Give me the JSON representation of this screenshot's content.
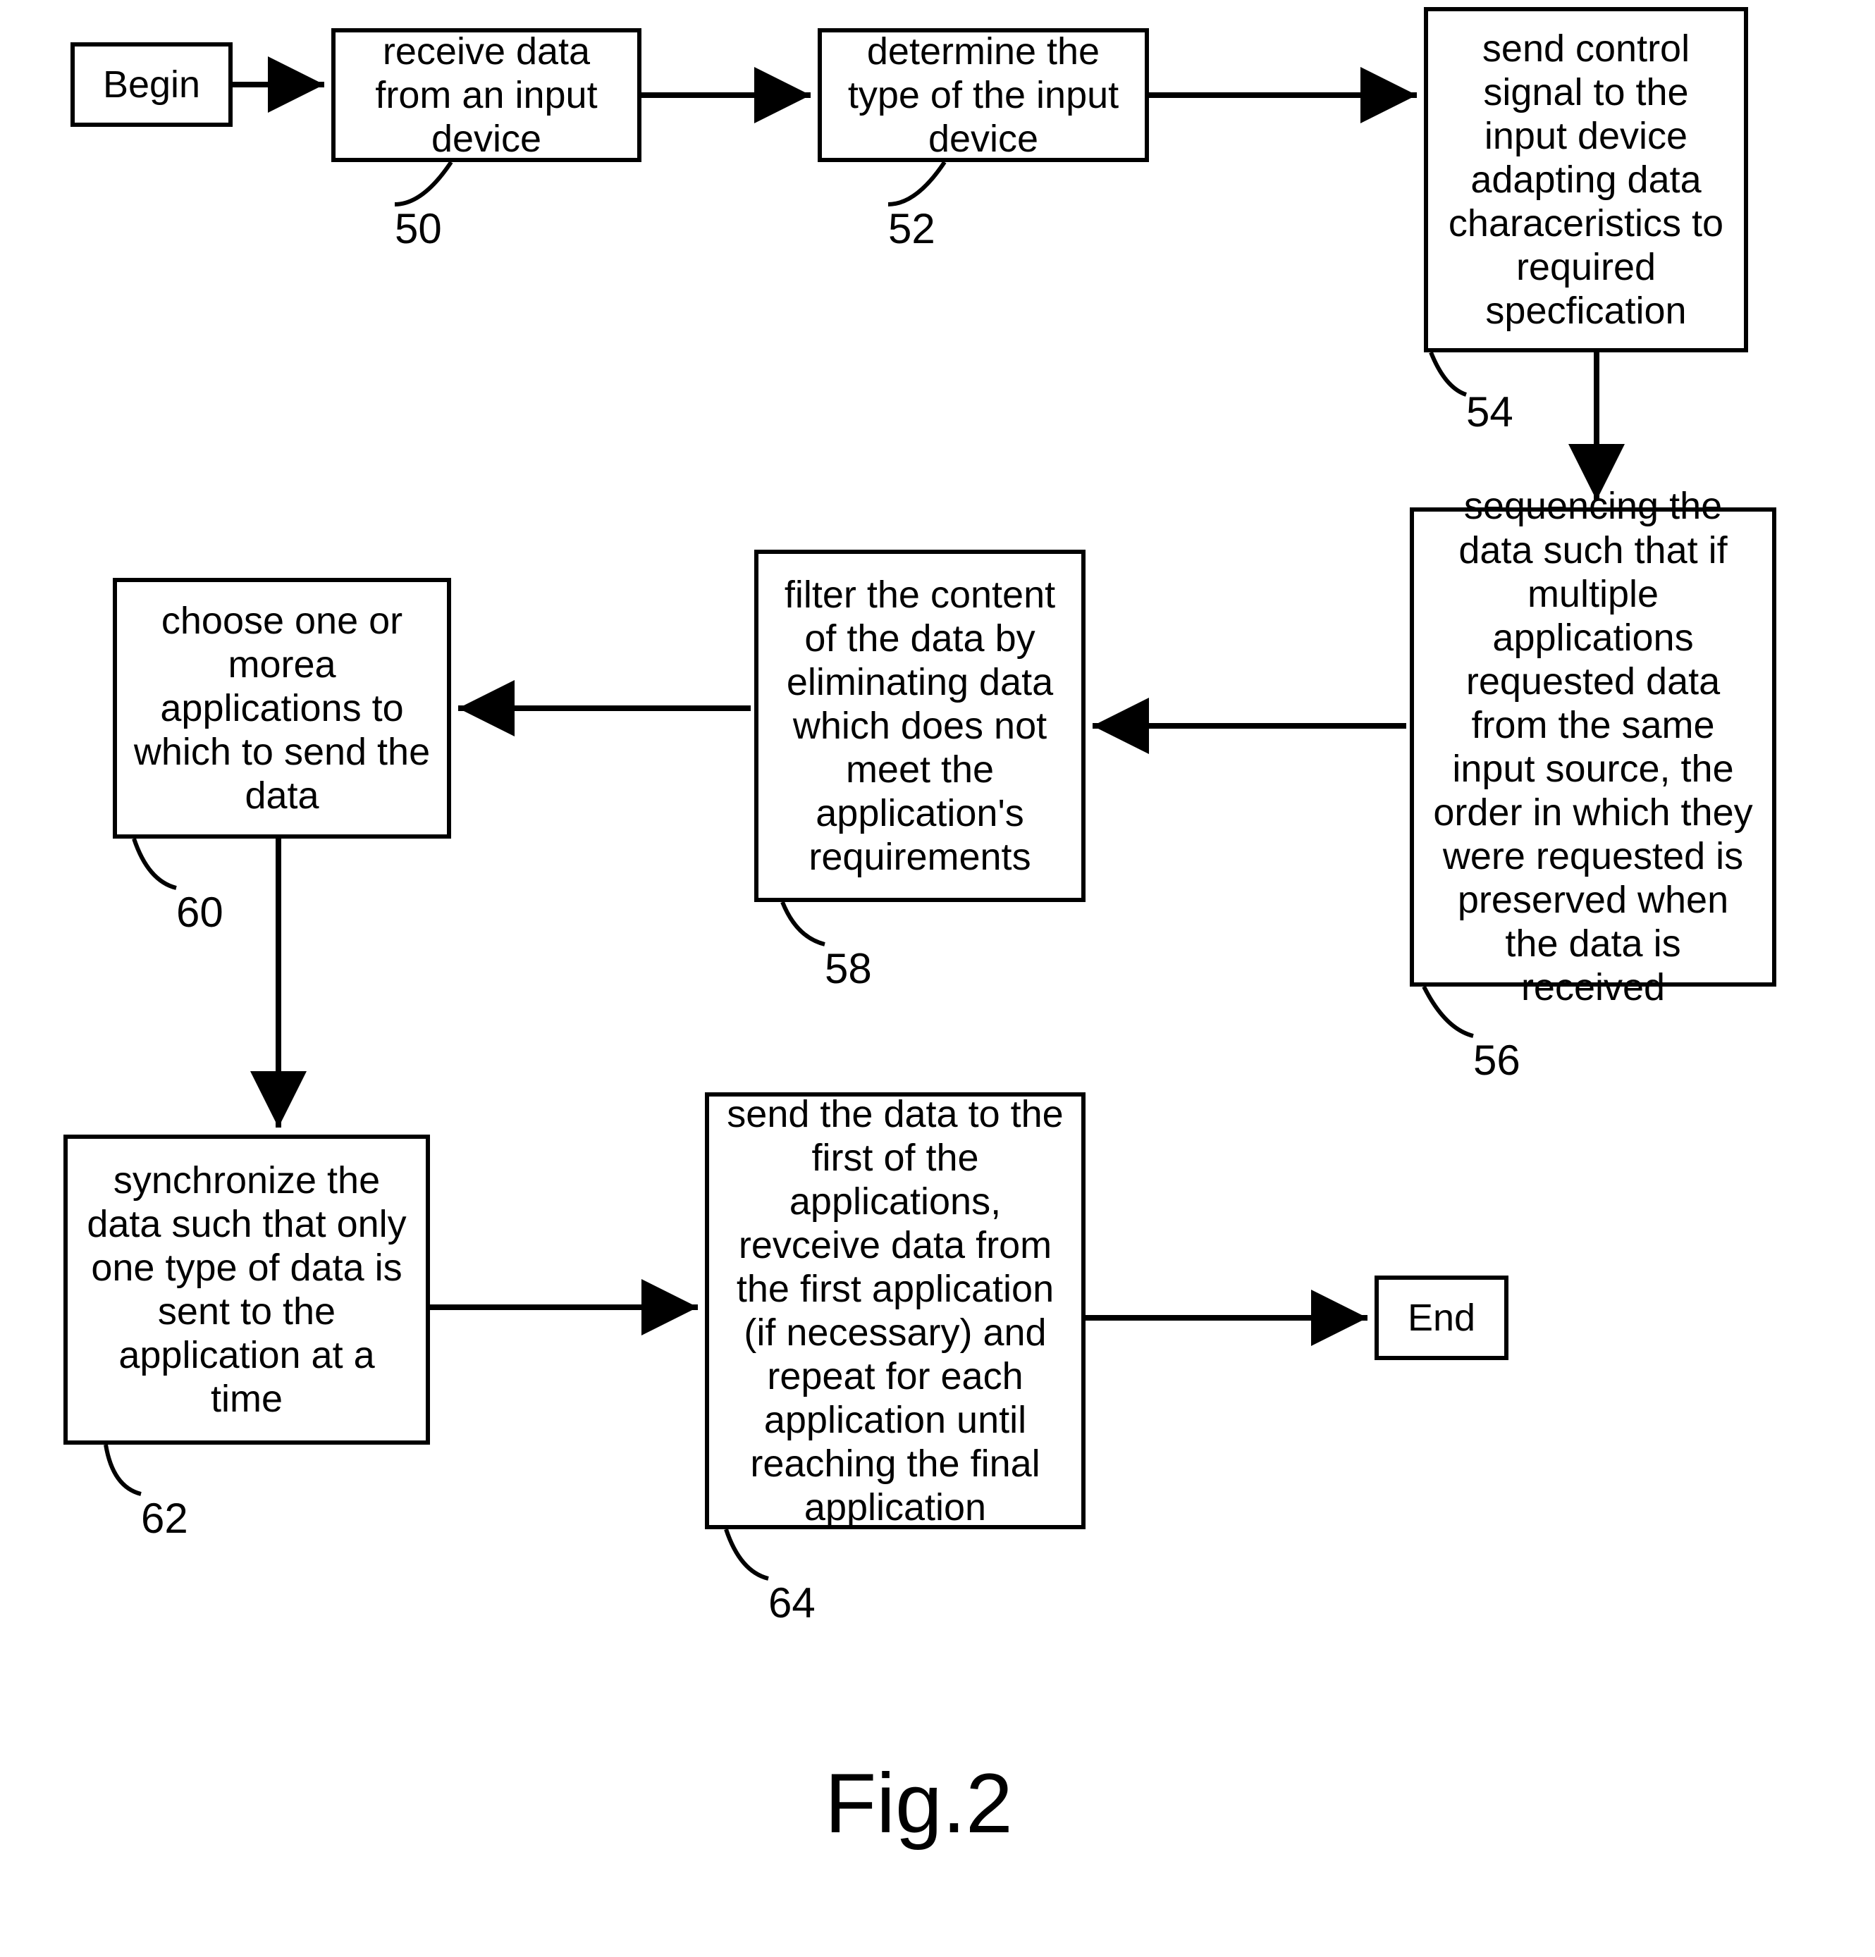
{
  "chart_data": {
    "type": "flowchart",
    "title": "Fig.2",
    "nodes": [
      {
        "id": "begin",
        "text": "Begin"
      },
      {
        "id": "50",
        "text": "receive data from an input device"
      },
      {
        "id": "52",
        "text": "determine the type of the input device"
      },
      {
        "id": "54",
        "text": "send control signal to the input device adapting data characeristics to required specfication"
      },
      {
        "id": "56",
        "text": "sequencing the data such that if multiple applications requested data from the same input source, the order in which they were requested is preserved when the data is received"
      },
      {
        "id": "58",
        "text": "filter the content of the data by eliminating data which does not meet the application's requirements"
      },
      {
        "id": "60",
        "text": "choose one or morea applications to which to send the data"
      },
      {
        "id": "62",
        "text": "synchronize the data such that only one type of data is sent to the application at a time"
      },
      {
        "id": "64",
        "text": "send the data to the first of the applications, revceive data from the first application (if necessary) and repeat for each application until reaching the final application"
      },
      {
        "id": "end",
        "text": "End"
      }
    ],
    "edges": [
      {
        "from": "begin",
        "to": "50"
      },
      {
        "from": "50",
        "to": "52"
      },
      {
        "from": "52",
        "to": "54"
      },
      {
        "from": "54",
        "to": "56"
      },
      {
        "from": "56",
        "to": "58"
      },
      {
        "from": "58",
        "to": "60"
      },
      {
        "from": "60",
        "to": "62"
      },
      {
        "from": "62",
        "to": "64"
      },
      {
        "from": "64",
        "to": "end"
      }
    ]
  },
  "labels": {
    "n50": "50",
    "n52": "52",
    "n54": "54",
    "n56": "56",
    "n58": "58",
    "n60": "60",
    "n62": "62",
    "n64": "64",
    "fig": "Fig.2"
  }
}
